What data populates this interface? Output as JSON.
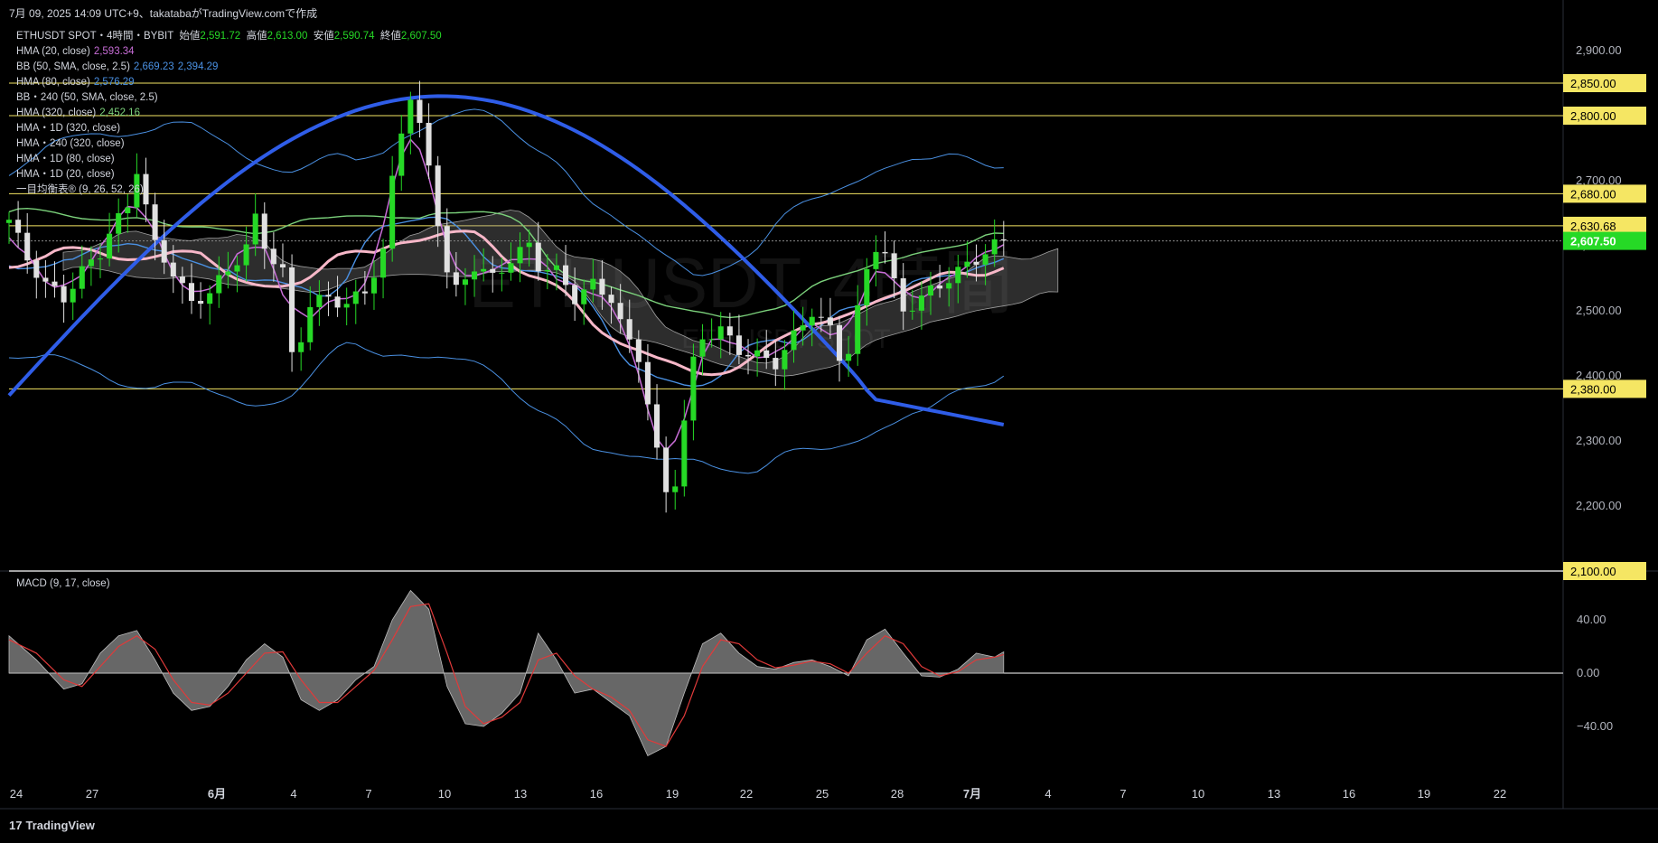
{
  "header": {
    "caption": "7月 09, 2025 14:09 UTC+9、takatabaがTradingView.comで作成"
  },
  "legend": {
    "symbol_line": {
      "symbol": "ETHUSDT SPOT・4時間・BYBIT",
      "open_label": "始値",
      "open": "2,591.72",
      "high_label": "高値",
      "high": "2,613.00",
      "low_label": "安値",
      "low": "2,590.74",
      "close_label": "終値",
      "close": "2,607.50"
    },
    "indicators": [
      {
        "label": "HMA (20, close)",
        "value": "2,593.34",
        "color": "#c86dd7"
      },
      {
        "label": "BB (50, SMA, close, 2.5)",
        "value": "2,669.23",
        "value2": "2,394.29",
        "color": "#4a90e2"
      },
      {
        "label": "HMA (80, close)",
        "value": "2,576.29",
        "color": "#4a90e2"
      },
      {
        "label": "BB・240 (50, SMA, close, 2.5)",
        "value": "",
        "color": "#d1d4dc"
      },
      {
        "label": "HMA (320, close)",
        "value": "2,452.16",
        "color": "#7bd17b"
      },
      {
        "label": "HMA・1D (320, close)",
        "value": "",
        "color": "#d1d4dc"
      },
      {
        "label": "HMA・240 (320, close)",
        "value": "",
        "color": "#d1d4dc"
      },
      {
        "label": "HMA・1D (80, close)",
        "value": "",
        "color": "#d1d4dc"
      },
      {
        "label": "HMA・1D (20, close)",
        "value": "",
        "color": "#d1d4dc"
      },
      {
        "label": "一目均衡表® (9, 26, 52, 26)",
        "value": "",
        "color": "#d1d4dc"
      }
    ]
  },
  "watermark": {
    "main": "ETHUSDT, 4時間",
    "sub": "ETHUSDT SPOT"
  },
  "macd_title": "MACD (9, 17, close)",
  "logo": {
    "mark": "17",
    "text": "TradingView"
  },
  "colors": {
    "up": "#26d926",
    "down": "#e0e0e0",
    "hline": "#f5e663",
    "label_bg": "#f5e663",
    "hma20": "#c86dd7",
    "hma80": "#4a90e2",
    "hma320": "#7bd17b",
    "hma_thick": "#2f5de8",
    "hma_pink": "#f7b7c8",
    "macd": "#e03a3a"
  },
  "chart_data": [
    {
      "type": "candlestick",
      "symbol": "ETHUSDT",
      "timeframe": "4時間",
      "x_ticks": [
        "24",
        "27",
        "6月",
        "4",
        "7",
        "10",
        "13",
        "16",
        "19",
        "22",
        "25",
        "28",
        "7月",
        "4",
        "7",
        "10",
        "13",
        "16",
        "19",
        "22"
      ],
      "y_ticks": [
        "2,200.00",
        "2,300.00",
        "2,400.00",
        "2,500.00",
        "2,600.00",
        "2,700.00",
        "2,800.00",
        "2,900.00"
      ],
      "ylim": [
        2100,
        2950
      ],
      "horizontal_lines": [
        2850,
        2800,
        2680,
        2630.68,
        2380
      ],
      "price_labels": [
        {
          "value": 2850,
          "text": "2,850.00"
        },
        {
          "value": 2800,
          "text": "2,800.00"
        },
        {
          "value": 2680,
          "text": "2,680.00"
        },
        {
          "value": 2630.68,
          "text": "2,630.68"
        },
        {
          "value": 2607.5,
          "text": "2,607.50",
          "last": true
        },
        {
          "value": 2380,
          "text": "2,380.00"
        },
        {
          "value": 2100,
          "text": "2,100.00"
        }
      ],
      "close_path": [
        [
          0,
          2640
        ],
        [
          2,
          2580
        ],
        [
          4,
          2540
        ],
        [
          6,
          2520
        ],
        [
          8,
          2560
        ],
        [
          10,
          2590
        ],
        [
          11,
          2620
        ],
        [
          13,
          2660
        ],
        [
          14,
          2720
        ],
        [
          15,
          2660
        ],
        [
          16,
          2600
        ],
        [
          18,
          2560
        ],
        [
          20,
          2510
        ],
        [
          22,
          2530
        ],
        [
          24,
          2560
        ],
        [
          26,
          2600
        ],
        [
          27,
          2640
        ],
        [
          28,
          2600
        ],
        [
          30,
          2560
        ],
        [
          31,
          2430
        ],
        [
          32,
          2460
        ],
        [
          33,
          2510
        ],
        [
          35,
          2520
        ],
        [
          37,
          2510
        ],
        [
          39,
          2530
        ],
        [
          41,
          2590
        ],
        [
          42,
          2700
        ],
        [
          43,
          2780
        ],
        [
          44,
          2830
        ],
        [
          45,
          2780
        ],
        [
          46,
          2720
        ],
        [
          47,
          2640
        ],
        [
          48,
          2560
        ],
        [
          49,
          2530
        ],
        [
          51,
          2570
        ],
        [
          53,
          2550
        ],
        [
          55,
          2580
        ],
        [
          57,
          2600
        ],
        [
          58,
          2570
        ],
        [
          60,
          2560
        ],
        [
          62,
          2520
        ],
        [
          64,
          2540
        ],
        [
          66,
          2520
        ],
        [
          67,
          2480
        ],
        [
          68,
          2450
        ],
        [
          69,
          2430
        ],
        [
          70,
          2360
        ],
        [
          71,
          2280
        ],
        [
          72,
          2220
        ],
        [
          73,
          2240
        ],
        [
          74,
          2330
        ],
        [
          75,
          2420
        ],
        [
          76,
          2460
        ],
        [
          78,
          2470
        ],
        [
          80,
          2440
        ],
        [
          82,
          2430
        ],
        [
          84,
          2420
        ],
        [
          86,
          2460
        ],
        [
          87,
          2480
        ],
        [
          88,
          2500
        ],
        [
          90,
          2470
        ],
        [
          91,
          2430
        ],
        [
          92,
          2440
        ],
        [
          93,
          2500
        ],
        [
          94,
          2560
        ],
        [
          95,
          2600
        ],
        [
          96,
          2590
        ],
        [
          97,
          2540
        ],
        [
          98,
          2500
        ],
        [
          100,
          2520
        ],
        [
          102,
          2540
        ],
        [
          104,
          2560
        ],
        [
          106,
          2580
        ],
        [
          108,
          2600
        ],
        [
          109,
          2607.5
        ]
      ],
      "series": [
        {
          "name": "HMA (20, close)",
          "values": "overlay"
        },
        {
          "name": "BB (50, SMA, close, 2.5)",
          "values": "overlay"
        },
        {
          "name": "HMA (80, close)",
          "values": "overlay"
        },
        {
          "name": "HMA (320, close)",
          "values": "overlay"
        }
      ]
    },
    {
      "type": "area",
      "title": "MACD (9, 17, close)",
      "y_ticks": [
        "40.00",
        "0.00",
        "−40.00"
      ],
      "ylim": [
        -70,
        70
      ],
      "histogram": [
        [
          0,
          28
        ],
        [
          3,
          10
        ],
        [
          6,
          -12
        ],
        [
          8,
          -8
        ],
        [
          10,
          15
        ],
        [
          12,
          28
        ],
        [
          14,
          32
        ],
        [
          16,
          10
        ],
        [
          18,
          -15
        ],
        [
          20,
          -28
        ],
        [
          22,
          -25
        ],
        [
          24,
          -10
        ],
        [
          26,
          10
        ],
        [
          28,
          22
        ],
        [
          30,
          12
        ],
        [
          32,
          -20
        ],
        [
          34,
          -28
        ],
        [
          36,
          -20
        ],
        [
          38,
          -5
        ],
        [
          40,
          5
        ],
        [
          42,
          40
        ],
        [
          44,
          62
        ],
        [
          46,
          48
        ],
        [
          48,
          -10
        ],
        [
          50,
          -38
        ],
        [
          52,
          -40
        ],
        [
          54,
          -30
        ],
        [
          56,
          -15
        ],
        [
          58,
          30
        ],
        [
          60,
          10
        ],
        [
          62,
          -15
        ],
        [
          64,
          -12
        ],
        [
          66,
          -22
        ],
        [
          68,
          -32
        ],
        [
          70,
          -62
        ],
        [
          72,
          -55
        ],
        [
          74,
          -15
        ],
        [
          76,
          22
        ],
        [
          78,
          30
        ],
        [
          80,
          15
        ],
        [
          82,
          5
        ],
        [
          84,
          3
        ],
        [
          86,
          8
        ],
        [
          88,
          10
        ],
        [
          90,
          5
        ],
        [
          92,
          -2
        ],
        [
          94,
          25
        ],
        [
          96,
          33
        ],
        [
          98,
          15
        ],
        [
          100,
          -2
        ],
        [
          102,
          -3
        ],
        [
          104,
          3
        ],
        [
          106,
          15
        ],
        [
          108,
          12
        ],
        [
          109,
          16
        ]
      ],
      "signal": [
        [
          0,
          25
        ],
        [
          3,
          15
        ],
        [
          6,
          -5
        ],
        [
          8,
          -10
        ],
        [
          10,
          5
        ],
        [
          12,
          20
        ],
        [
          14,
          28
        ],
        [
          16,
          18
        ],
        [
          18,
          -5
        ],
        [
          20,
          -22
        ],
        [
          22,
          -24
        ],
        [
          24,
          -15
        ],
        [
          26,
          0
        ],
        [
          28,
          15
        ],
        [
          30,
          16
        ],
        [
          32,
          -5
        ],
        [
          34,
          -22
        ],
        [
          36,
          -22
        ],
        [
          38,
          -10
        ],
        [
          40,
          2
        ],
        [
          42,
          25
        ],
        [
          44,
          50
        ],
        [
          46,
          52
        ],
        [
          48,
          15
        ],
        [
          50,
          -25
        ],
        [
          52,
          -38
        ],
        [
          54,
          -33
        ],
        [
          56,
          -22
        ],
        [
          58,
          10
        ],
        [
          60,
          15
        ],
        [
          62,
          -2
        ],
        [
          64,
          -12
        ],
        [
          66,
          -18
        ],
        [
          68,
          -28
        ],
        [
          70,
          -50
        ],
        [
          72,
          -55
        ],
        [
          74,
          -32
        ],
        [
          76,
          5
        ],
        [
          78,
          25
        ],
        [
          80,
          22
        ],
        [
          82,
          10
        ],
        [
          84,
          4
        ],
        [
          86,
          6
        ],
        [
          88,
          9
        ],
        [
          90,
          7
        ],
        [
          92,
          0
        ],
        [
          94,
          15
        ],
        [
          96,
          28
        ],
        [
          98,
          22
        ],
        [
          100,
          5
        ],
        [
          102,
          -2
        ],
        [
          104,
          1
        ],
        [
          106,
          10
        ],
        [
          108,
          12
        ],
        [
          109,
          14
        ]
      ]
    }
  ]
}
